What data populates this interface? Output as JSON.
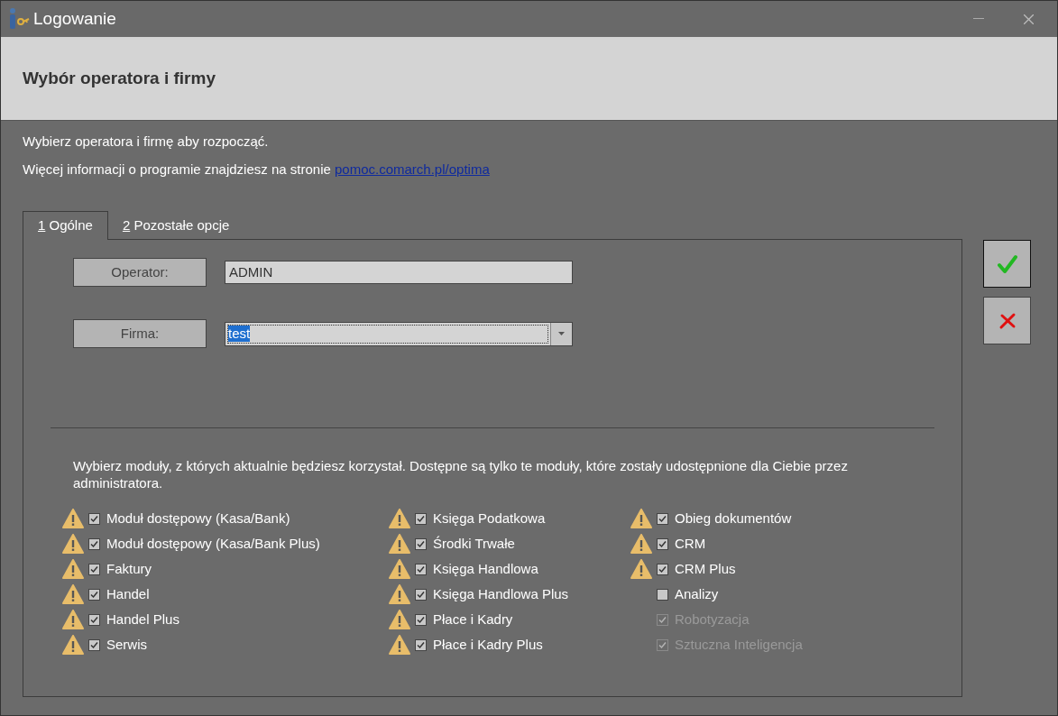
{
  "window": {
    "title": "Logowanie"
  },
  "header": {
    "title": "Wybór operatora i firmy"
  },
  "intro": [
    {
      "text": "Wybierz operatora i firmę aby rozpocząć."
    },
    {
      "text": "Więcej informacji o programie znajdziesz na stronie ",
      "link": "pomoc.comarch.pl/optima"
    }
  ],
  "tabs": [
    {
      "key": "1",
      "label": "Ogólne",
      "selected": true
    },
    {
      "key": "2",
      "label": "Pozostałe opcje",
      "selected": false
    }
  ],
  "fields": [
    {
      "label": "Operator:",
      "value": "ADMIN",
      "kind": "text"
    },
    {
      "label": "Firma:",
      "value": "test",
      "kind": "dropdown"
    }
  ],
  "modules_hint": "Wybierz moduły, z których aktualnie będziesz korzystał. Dostępne są tylko te moduły, które zostały udostępnione dla Ciebie przez administratora.",
  "module_columns": [
    [
      {
        "label": "Moduł dostępowy (Kasa/Bank)",
        "checked": true,
        "warning": true,
        "disabled": false
      },
      {
        "label": "Moduł dostępowy (Kasa/Bank Plus)",
        "checked": true,
        "warning": true,
        "disabled": false
      },
      {
        "label": "Faktury",
        "checked": true,
        "warning": true,
        "disabled": false
      },
      {
        "label": "Handel",
        "checked": true,
        "warning": true,
        "disabled": false
      },
      {
        "label": "Handel Plus",
        "checked": true,
        "warning": true,
        "disabled": false
      },
      {
        "label": "Serwis",
        "checked": true,
        "warning": true,
        "disabled": false
      }
    ],
    [
      {
        "label": "Księga Podatkowa",
        "checked": true,
        "warning": true,
        "disabled": false
      },
      {
        "label": "Środki Trwałe",
        "checked": true,
        "warning": true,
        "disabled": false
      },
      {
        "label": "Księga Handlowa",
        "checked": true,
        "warning": true,
        "disabled": false
      },
      {
        "label": "Księga Handlowa Plus",
        "checked": true,
        "warning": true,
        "disabled": false
      },
      {
        "label": "Płace i Kadry",
        "checked": true,
        "warning": true,
        "disabled": false
      },
      {
        "label": "Płace i Kadry Plus",
        "checked": true,
        "warning": true,
        "disabled": false
      }
    ],
    [
      {
        "label": "Obieg dokumentów",
        "checked": true,
        "warning": true,
        "disabled": false
      },
      {
        "label": "CRM",
        "checked": true,
        "warning": true,
        "disabled": false
      },
      {
        "label": "CRM Plus",
        "checked": true,
        "warning": true,
        "disabled": false
      },
      {
        "label": "Analizy",
        "checked": false,
        "warning": false,
        "disabled": false
      },
      {
        "label": "Robotyzacja",
        "checked": true,
        "warning": false,
        "disabled": true
      },
      {
        "label": "Sztuczna Inteligencja",
        "checked": true,
        "warning": false,
        "disabled": true
      }
    ]
  ]
}
